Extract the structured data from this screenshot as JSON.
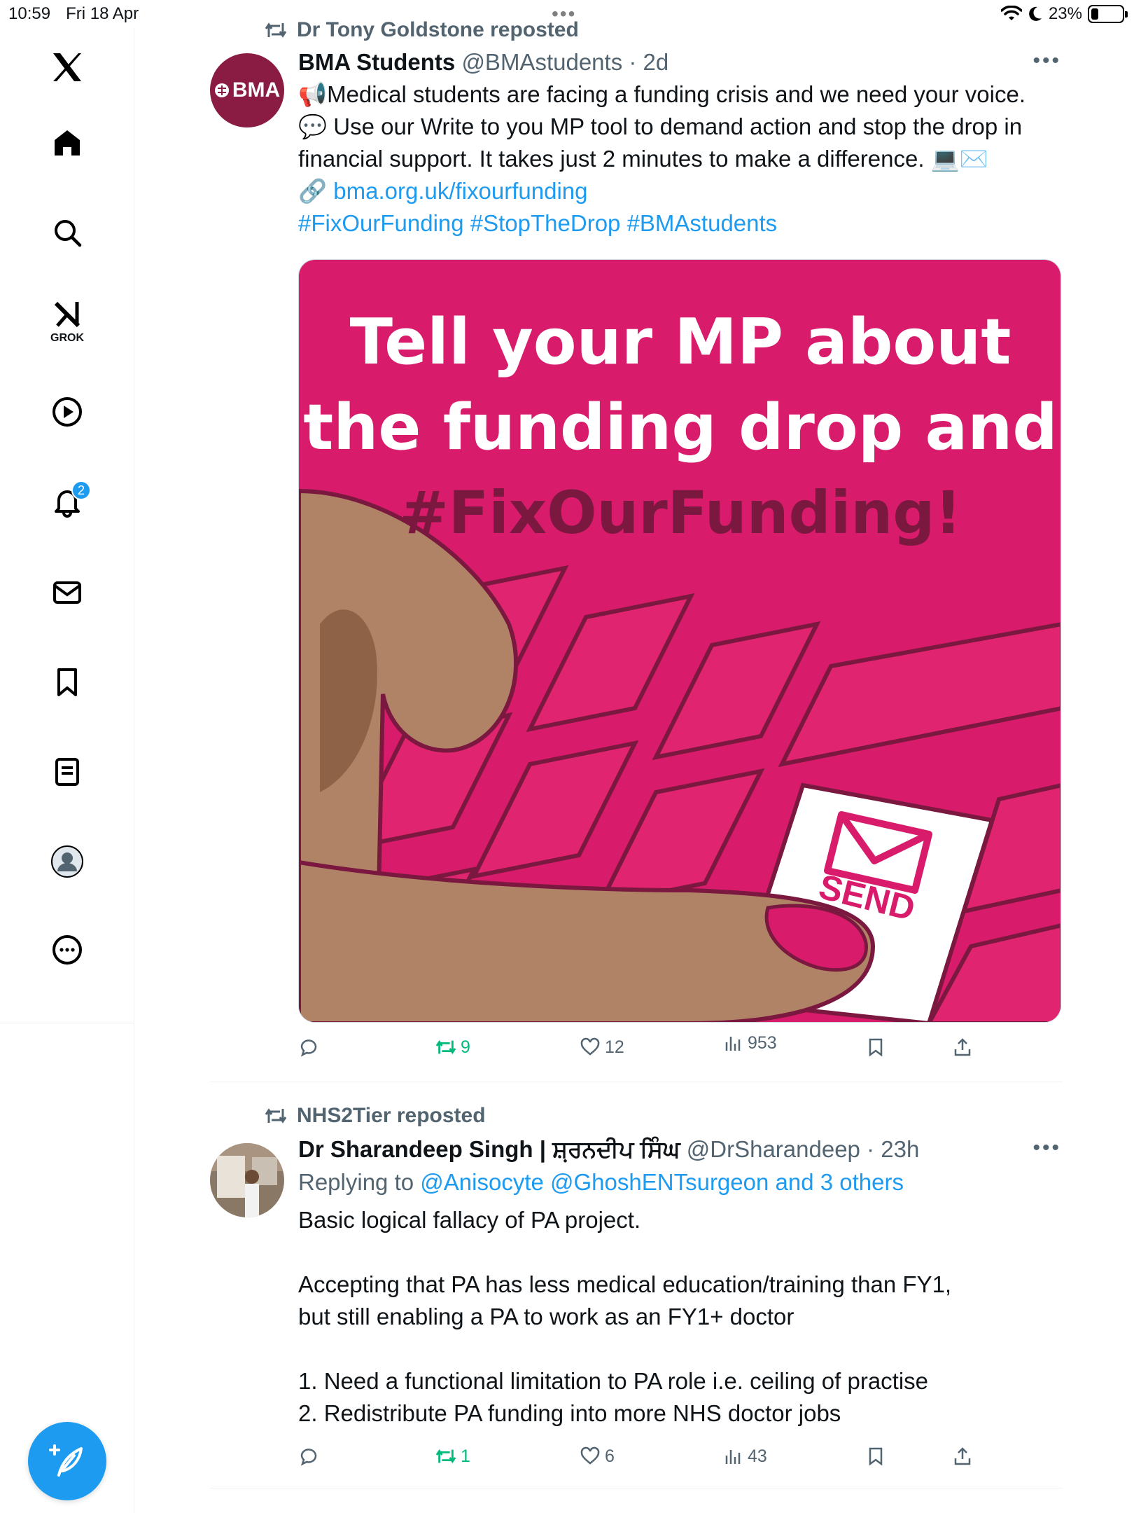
{
  "status_bar": {
    "time": "10:59",
    "date": "Fri 18 Apr",
    "battery": "23%",
    "battery_level": 0.23
  },
  "sidebar": {
    "items": [
      {
        "name": "x-logo",
        "label": ""
      },
      {
        "name": "home",
        "label": ""
      },
      {
        "name": "search",
        "label": ""
      },
      {
        "name": "grok",
        "label": "GROK"
      },
      {
        "name": "video",
        "label": ""
      },
      {
        "name": "notifications",
        "label": "",
        "badge": "2"
      },
      {
        "name": "messages",
        "label": ""
      },
      {
        "name": "bookmarks",
        "label": ""
      },
      {
        "name": "lists",
        "label": ""
      },
      {
        "name": "profile",
        "label": ""
      },
      {
        "name": "more",
        "label": ""
      }
    ]
  },
  "posts": [
    {
      "reposted_by": "Dr Tony Goldstone reposted",
      "avatar_text": "BMA",
      "author_name": "BMA Students",
      "handle": "@BMAstudents",
      "time": "2d",
      "text_lines": [
        "📢Medical students are facing a funding crisis and we need your voice.",
        "💬 Use our Write to you MP tool to demand action and stop the drop in",
        "financial support. It takes just 2 minutes to make a difference. 💻✉️"
      ],
      "link_icon": "🔗",
      "link": "bma.org.uk/fixourfunding",
      "hashtags": "#FixOurFunding #StopTheDrop #BMAstudents",
      "image": {
        "line1": "Tell your MP about",
        "line2": "the funding drop and",
        "line3": "#FixOurFunding!",
        "send_label": "SEND"
      },
      "actions": {
        "reply": "",
        "repost": "9",
        "like": "12",
        "views": "953"
      }
    },
    {
      "reposted_by": "NHS2Tier reposted",
      "author_name": "Dr Sharandeep Singh | ਸ਼਼ਰਨਦੀਪ ਸਿੰਘ",
      "handle": "@DrSharandeep",
      "time": "23h",
      "replying_prefix": "Replying to",
      "replying_to": "@Anisocyte @GhoshENTsurgeon and 3 others",
      "text_lines": [
        "Basic logical fallacy of PA project.",
        "",
        "Accepting that PA has less medical education/training than FY1,",
        "but still enabling a PA to work as an FY1+ doctor",
        "",
        "1. Need a functional limitation to PA role i.e. ceiling of practise",
        "2. Redistribute PA funding into more NHS doctor jobs"
      ],
      "actions": {
        "reply": "",
        "repost": "1",
        "like": "6",
        "views": "43"
      }
    }
  ],
  "colors": {
    "accent": "#1d9bf0",
    "secondary_text": "#536471",
    "repost_green": "#00ba7c",
    "image_pink": "#d81b6a",
    "image_dark": "#7a1840",
    "bma_maroon": "#8a1c43"
  }
}
